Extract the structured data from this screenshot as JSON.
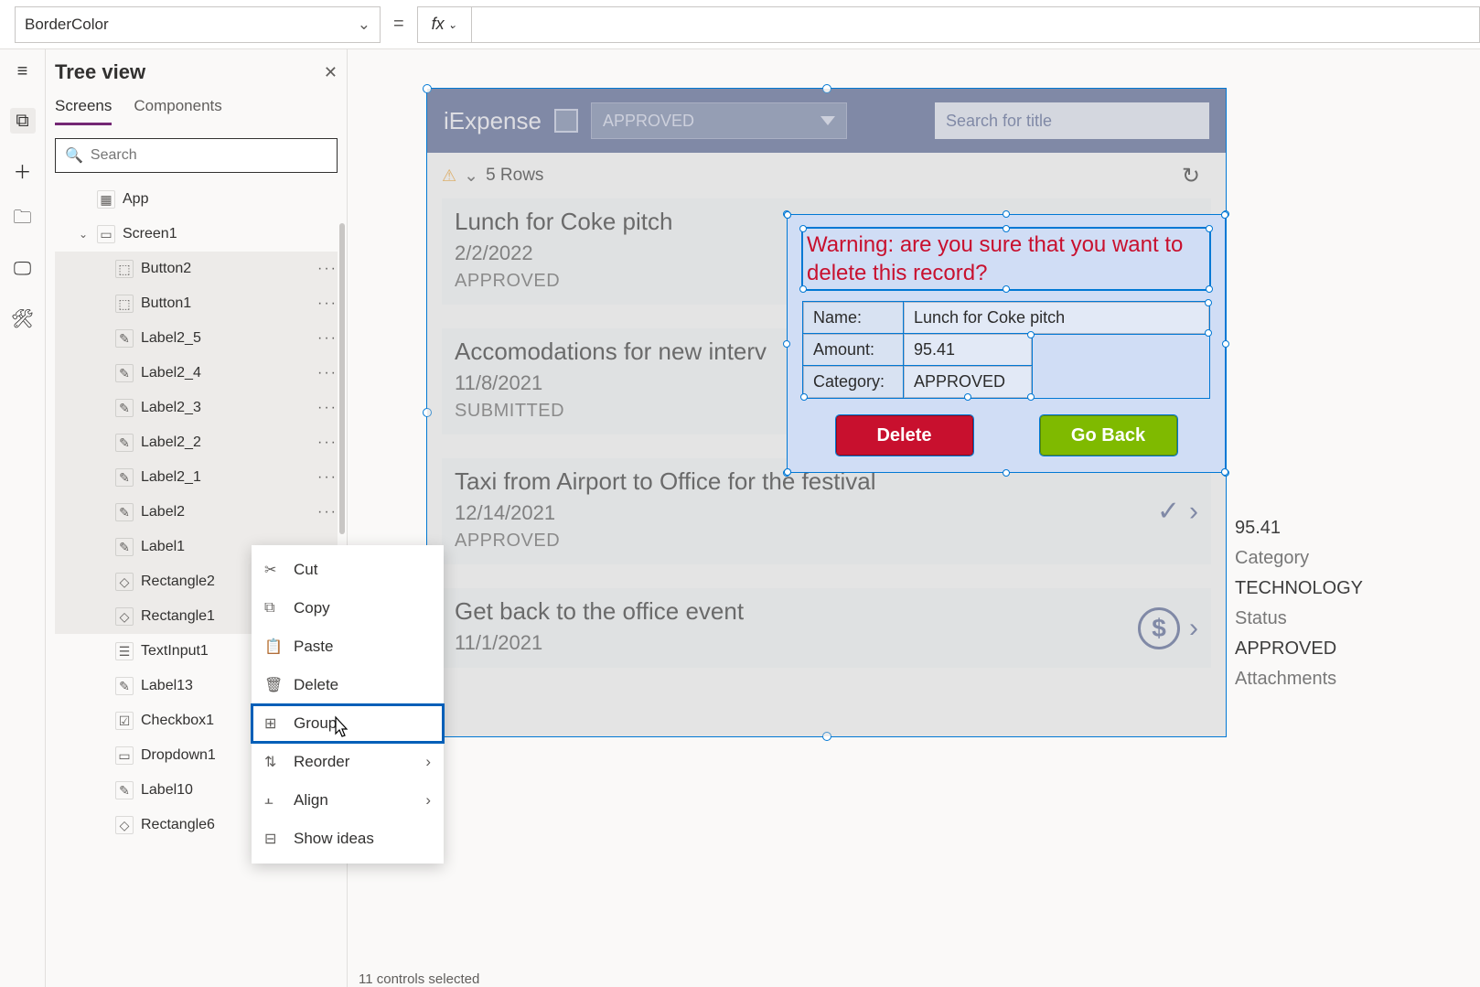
{
  "property_selector": "BorderColor",
  "tree": {
    "title": "Tree view",
    "tabs": {
      "screens": "Screens",
      "components": "Components"
    },
    "search_placeholder": "Search",
    "items": [
      {
        "label": "App",
        "icon": "▦",
        "indent": 1
      },
      {
        "label": "Screen1",
        "icon": "▭",
        "indent": 1,
        "chev": true
      },
      {
        "label": "Button2",
        "icon": "⬚",
        "indent": 2,
        "sel": true,
        "dots": true
      },
      {
        "label": "Button1",
        "icon": "⬚",
        "indent": 2,
        "sel": true,
        "dots": true
      },
      {
        "label": "Label2_5",
        "icon": "✎",
        "indent": 2,
        "sel": true,
        "dots": true
      },
      {
        "label": "Label2_4",
        "icon": "✎",
        "indent": 2,
        "sel": true,
        "dots": true
      },
      {
        "label": "Label2_3",
        "icon": "✎",
        "indent": 2,
        "sel": true,
        "dots": true
      },
      {
        "label": "Label2_2",
        "icon": "✎",
        "indent": 2,
        "sel": true,
        "dots": true
      },
      {
        "label": "Label2_1",
        "icon": "✎",
        "indent": 2,
        "sel": true,
        "dots": true
      },
      {
        "label": "Label2",
        "icon": "✎",
        "indent": 2,
        "sel": true,
        "dots": true
      },
      {
        "label": "Label1",
        "icon": "✎",
        "indent": 2,
        "sel": true
      },
      {
        "label": "Rectangle2",
        "icon": "◇",
        "indent": 2,
        "sel": true
      },
      {
        "label": "Rectangle1",
        "icon": "◇",
        "indent": 2,
        "sel": true
      },
      {
        "label": "TextInput1",
        "icon": "☰",
        "indent": 2
      },
      {
        "label": "Label13",
        "icon": "✎",
        "indent": 2
      },
      {
        "label": "Checkbox1",
        "icon": "☑",
        "indent": 2
      },
      {
        "label": "Dropdown1",
        "icon": "▭",
        "indent": 2
      },
      {
        "label": "Label10",
        "icon": "✎",
        "indent": 2
      },
      {
        "label": "Rectangle6",
        "icon": "◇",
        "indent": 2
      }
    ]
  },
  "context_menu": {
    "cut": "Cut",
    "copy": "Copy",
    "paste": "Paste",
    "delete": "Delete",
    "group": "Group",
    "reorder": "Reorder",
    "align": "Align",
    "show_ideas": "Show ideas"
  },
  "app": {
    "title": "iExpense",
    "filter_value": "APPROVED",
    "search_placeholder": "Search for title",
    "rows_label": "5 Rows",
    "expenses": [
      {
        "title": "Lunch for Coke pitch",
        "date": "2/2/2022",
        "status": "APPROVED"
      },
      {
        "title": "Accomodations for new interv",
        "date": "11/8/2021",
        "status": "SUBMITTED"
      },
      {
        "title": "Taxi from Airport to Office for the festival",
        "date": "12/14/2021",
        "status": "APPROVED",
        "check": true
      },
      {
        "title": "Get back to the office event",
        "date": "11/1/2021",
        "status": "",
        "dollar": true
      }
    ],
    "detail": {
      "amount_value": "95.41",
      "category_label": "Category",
      "category_value": "TECHNOLOGY",
      "status_label": "Status",
      "status_value": "APPROVED",
      "attachments_label": "Attachments"
    }
  },
  "dialog": {
    "warning": "Warning: are you sure that you want to delete this record?",
    "name_label": "Name:",
    "name_value": "Lunch for Coke pitch",
    "amount_label": "Amount:",
    "amount_value": "95.41",
    "category_label": "Category:",
    "category_value": "APPROVED",
    "delete_btn": "Delete",
    "goback_btn": "Go Back"
  },
  "status_bar": "11 controls selected"
}
